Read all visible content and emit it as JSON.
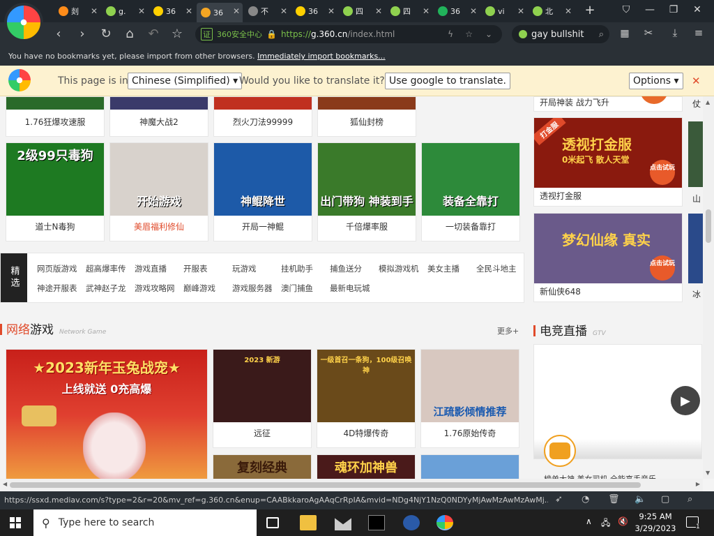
{
  "browser": {
    "tabs": [
      {
        "label": "剡",
        "color": "#ff8c1a"
      },
      {
        "label": "g.",
        "color": "#8fd14f"
      },
      {
        "label": "36",
        "color": "#ffd000"
      },
      {
        "label": "36",
        "color": "#f5a623"
      },
      {
        "label": "不",
        "color": "#888"
      },
      {
        "label": "36",
        "color": "#ffd000"
      },
      {
        "label": "四",
        "color": "#8fd14f"
      },
      {
        "label": "四",
        "color": "#8fd14f"
      },
      {
        "label": "36",
        "color": "#21b35b"
      },
      {
        "label": "vi",
        "color": "#8fd14f"
      },
      {
        "label": "北",
        "color": "#8fd14f"
      }
    ],
    "url_badge": "360安全中心",
    "url": "https://g.360.cn/index.html",
    "url_prefix": "https://",
    "url_host": "g.360.cn",
    "url_path": "/index.html",
    "search_text": "gay bullshit",
    "bookmark_msg": "You have no bookmarks yet, please import from other browsers.",
    "bookmark_link": "Immediately import bookmarks..."
  },
  "translate": {
    "prefix": "This page is in",
    "language": "Chinese (Simplified)",
    "question": "Would you like to translate it?",
    "button": "Use google to translate.",
    "options": "Options"
  },
  "games_top": [
    {
      "caption": "1.76狂爆攻速服"
    },
    {
      "caption": "神魔大战2"
    },
    {
      "caption": "烈火刀法99999"
    },
    {
      "caption": "狐仙封榜"
    }
  ],
  "games_row2": [
    {
      "caption": "道士N毒狗",
      "img_text": "2级99只毒狗",
      "bg": "#1e7a22"
    },
    {
      "caption": "美眉福利修仙",
      "img_text": "开始游戏",
      "bg": "#d8d2cc",
      "red": true
    },
    {
      "caption": "开局一神鲲",
      "img_text": "神鲲降世",
      "bg": "#1d5aa8"
    },
    {
      "caption": "千倍爆率服",
      "img_text": "出门带狗 神装到手",
      "bg": "#3a7a2a"
    },
    {
      "caption": "一切装备靠打",
      "img_text": "装备全靠打",
      "bg": "#2d8a3a"
    }
  ],
  "side_top": {
    "caption": "开局神装 战力飞升",
    "caption2": "仗"
  },
  "side_cards": [
    {
      "caption": "透视打金服",
      "img_text": "透视打金服",
      "sub": "0米起飞 散人天堂",
      "tag": "打金服",
      "btn": "点击试玩",
      "bg": "#8a1a0e"
    },
    {
      "caption": "新仙侠648",
      "img_text": "梦幻仙缘 真实",
      "btn": "点击试玩",
      "bg": "#6a5a8a"
    }
  ],
  "side_right": [
    "山",
    "冰"
  ],
  "jingxuan": {
    "tag": "精选",
    "row1": [
      "网页版游戏",
      "超高爆率传",
      "游戏直播",
      "开服表",
      "玩游戏",
      "挂机助手",
      "捕鱼送分",
      "模拟游戏机",
      "美女主播",
      "全民斗地主"
    ],
    "row2": [
      "神途开服表",
      "武神赵子龙",
      "游戏攻略网",
      "巅峰游戏",
      "游戏服务器",
      "澳门捕鱼",
      "最新电玩城"
    ]
  },
  "network_section": {
    "title_red": "网络",
    "title_rest": "游戏",
    "sub": "Network Game",
    "more": "更多+"
  },
  "esports_section": {
    "title": "电竞直播",
    "sub": "GTV"
  },
  "big_banner": {
    "line1": "★2023新年玉兔战宠★",
    "line2": "上线就送 0充高爆",
    "bg": "#c8201a"
  },
  "net_games": [
    {
      "caption": "远征",
      "img_text": "2023 新游",
      "bg": "#3a1a1a"
    },
    {
      "caption": "4D特爆传奇",
      "img_text": "一级首召一条狗，100级召唤神",
      "bg": "#6a4a1a"
    },
    {
      "caption": "1.76原始传奇",
      "img_text": "江疏影倾情推荐",
      "bg": "#d8c8c0"
    }
  ],
  "net_games2": [
    {
      "img_text": "复刻经典",
      "bg": "#8a6a3a"
    },
    {
      "img_text": "魂环加神兽",
      "bg": "#4a1a1a"
    },
    {
      "img_text": "",
      "bg": "#6aa0d8"
    }
  ],
  "live_caption": "榜单大神 美女司机 全能高手音乐",
  "status_url": "https://ssxd.mediav.com/s?type=2&r=20&mv_ref=g.360.cn&enup=CAABkkaroAgAAqCrRpIA&mvid=NDg4NjY1NzQ0NDYyMjAwMzAwMzAwMj...",
  "taskbar": {
    "search_placeholder": "Type here to search",
    "time": "9:25 AM",
    "date": "3/29/2023",
    "notif_count": "1"
  }
}
